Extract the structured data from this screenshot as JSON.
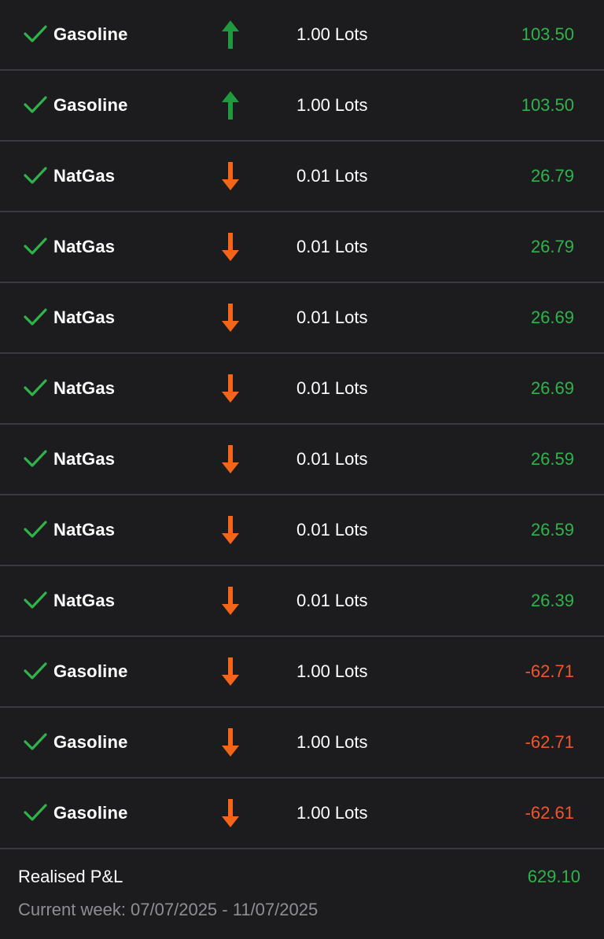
{
  "colors": {
    "background": "#1c1c1f",
    "divider": "#3a3b40",
    "check": "#2fb34a",
    "arrow_up": "#1f9a3e",
    "arrow_down": "#f3661a",
    "positive": "#2fb34a",
    "negative": "#f1552b",
    "muted": "#8e8f94"
  },
  "trades": [
    {
      "status_icon": "check-icon",
      "instrument": "Gasoline",
      "direction": "up",
      "volume": "1.00 Lots",
      "pl": "103.50",
      "pl_sign": "pos"
    },
    {
      "status_icon": "check-icon",
      "instrument": "Gasoline",
      "direction": "up",
      "volume": "1.00 Lots",
      "pl": "103.50",
      "pl_sign": "pos"
    },
    {
      "status_icon": "check-icon",
      "instrument": "NatGas",
      "direction": "down",
      "volume": "0.01 Lots",
      "pl": "26.79",
      "pl_sign": "pos"
    },
    {
      "status_icon": "check-icon",
      "instrument": "NatGas",
      "direction": "down",
      "volume": "0.01 Lots",
      "pl": "26.79",
      "pl_sign": "pos"
    },
    {
      "status_icon": "check-icon",
      "instrument": "NatGas",
      "direction": "down",
      "volume": "0.01 Lots",
      "pl": "26.69",
      "pl_sign": "pos"
    },
    {
      "status_icon": "check-icon",
      "instrument": "NatGas",
      "direction": "down",
      "volume": "0.01 Lots",
      "pl": "26.69",
      "pl_sign": "pos"
    },
    {
      "status_icon": "check-icon",
      "instrument": "NatGas",
      "direction": "down",
      "volume": "0.01 Lots",
      "pl": "26.59",
      "pl_sign": "pos"
    },
    {
      "status_icon": "check-icon",
      "instrument": "NatGas",
      "direction": "down",
      "volume": "0.01 Lots",
      "pl": "26.59",
      "pl_sign": "pos"
    },
    {
      "status_icon": "check-icon",
      "instrument": "NatGas",
      "direction": "down",
      "volume": "0.01 Lots",
      "pl": "26.39",
      "pl_sign": "pos"
    },
    {
      "status_icon": "check-icon",
      "instrument": "Gasoline",
      "direction": "down",
      "volume": "1.00 Lots",
      "pl": "-62.71",
      "pl_sign": "neg"
    },
    {
      "status_icon": "check-icon",
      "instrument": "Gasoline",
      "direction": "down",
      "volume": "1.00 Lots",
      "pl": "-62.71",
      "pl_sign": "neg"
    },
    {
      "status_icon": "check-icon",
      "instrument": "Gasoline",
      "direction": "down",
      "volume": "1.00 Lots",
      "pl": "-62.61",
      "pl_sign": "neg"
    }
  ],
  "footer": {
    "realised_label": "Realised P&L",
    "realised_value": "629.10",
    "week_text": "Current week: 07/07/2025 - 11/07/2025"
  }
}
